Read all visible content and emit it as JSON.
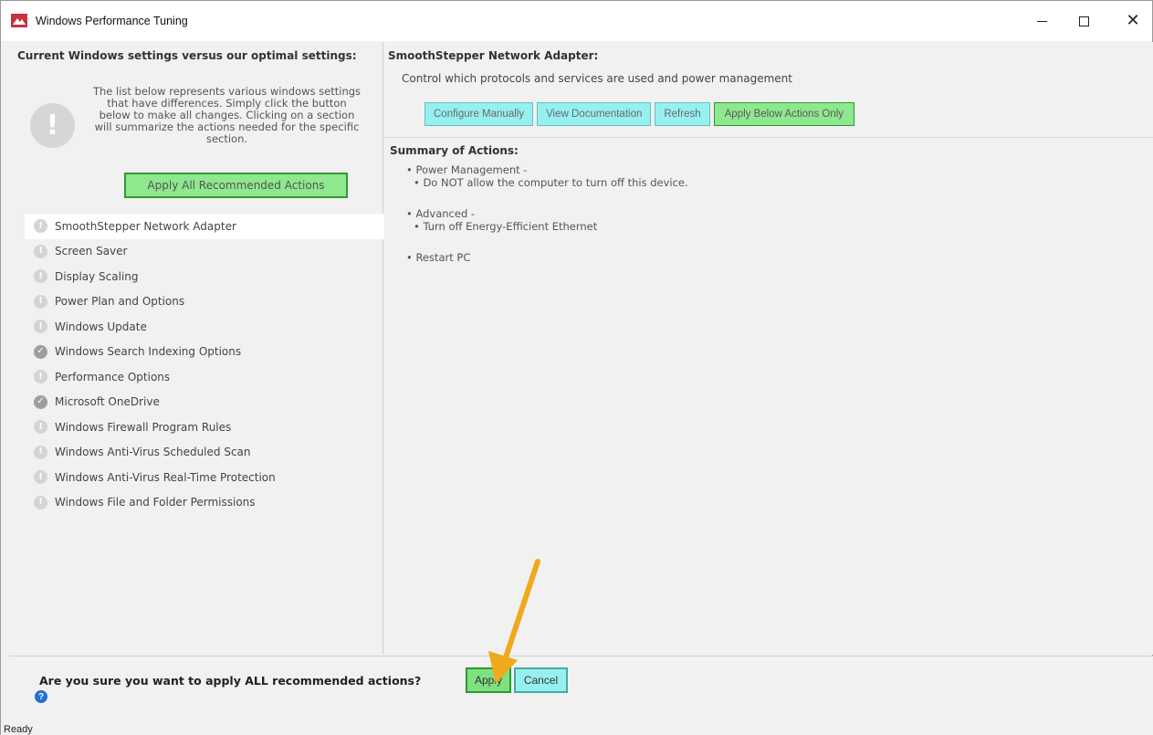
{
  "window": {
    "title": "Windows Performance Tuning"
  },
  "left": {
    "header": "Current Windows settings versus our optimal settings:",
    "description": "The list below represents various windows settings that have differences. Simply click the button below to make all changes. Clicking on a section will summarize the actions needed for the specific section.",
    "apply_all_label": "Apply All Recommended Actions",
    "sections": [
      {
        "label": "SmoothStepper Network Adapter",
        "state": "warning",
        "selected": true
      },
      {
        "label": "Screen Saver",
        "state": "warning"
      },
      {
        "label": "Display Scaling",
        "state": "warning"
      },
      {
        "label": "Power Plan and Options",
        "state": "warning"
      },
      {
        "label": "Windows Update",
        "state": "warning"
      },
      {
        "label": "Windows Search Indexing Options",
        "state": "ok"
      },
      {
        "label": "Performance Options",
        "state": "warning"
      },
      {
        "label": "Microsoft OneDrive",
        "state": "ok"
      },
      {
        "label": "Windows Firewall Program Rules",
        "state": "warning"
      },
      {
        "label": "Windows Anti-Virus Scheduled Scan",
        "state": "warning"
      },
      {
        "label": "Windows Anti-Virus Real-Time Protection",
        "state": "warning"
      },
      {
        "label": "Windows File and Folder Permissions",
        "state": "warning"
      }
    ]
  },
  "right": {
    "title": "SmoothStepper Network Adapter:",
    "description": "Control which protocols and services are used and power management",
    "buttons": {
      "configure": "Configure Manually",
      "docs": "View Documentation",
      "refresh": "Refresh",
      "apply_below": "Apply Below Actions Only"
    },
    "summary_title": "Summary of Actions:",
    "summary": [
      {
        "heading": "• Power Management -",
        "items": [
          "• Do NOT allow the computer to turn off this device."
        ]
      },
      {
        "heading": "• Advanced -",
        "items": [
          "• Turn off Energy-Efficient Ethernet"
        ]
      },
      {
        "heading": "• Restart PC",
        "items": []
      }
    ]
  },
  "confirm": {
    "question": "Are you sure you want to apply ALL recommended actions?",
    "apply_label": "Apply",
    "cancel_label": "Cancel"
  },
  "status": {
    "text": "Ready"
  },
  "colors": {
    "green_button": "#8ee88e",
    "cyan_button": "#96f0f0",
    "arrow": "#f0a81c",
    "info_icon": "#1f6fd6",
    "app_icon": "#c8323c"
  }
}
